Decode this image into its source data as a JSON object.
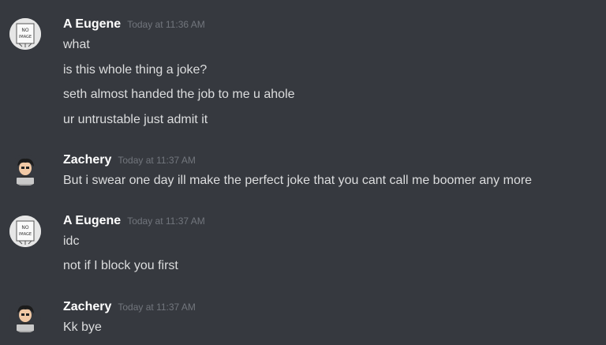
{
  "messages": [
    {
      "username": "A Eugene",
      "avatar": "no-image-avatar",
      "timestamp": "Today at 11:36 AM",
      "lines": [
        "what",
        "is this whole thing a joke?",
        "seth almost handed the job to me u ahole",
        "ur untrustable just admit it"
      ]
    },
    {
      "username": "Zachery",
      "avatar": "person-with-laptop-avatar",
      "timestamp": "Today at 11:37 AM",
      "lines": [
        "But i swear one day ill make the perfect joke that you cant call me boomer any more"
      ]
    },
    {
      "username": "A Eugene",
      "avatar": "no-image-avatar",
      "timestamp": "Today at 11:37 AM",
      "lines": [
        "idc",
        "not if I block you first"
      ]
    },
    {
      "username": "Zachery",
      "avatar": "person-with-laptop-avatar",
      "timestamp": "Today at 11:37 AM",
      "lines": [
        "Kk bye"
      ]
    }
  ],
  "colors": {
    "background": "#36393f",
    "username": "#ffffff",
    "message_text": "#dcddde",
    "timestamp": "#72767d"
  },
  "avatar_text": {
    "no_image_line1": "NO",
    "no_image_line2": "IMAGE"
  }
}
